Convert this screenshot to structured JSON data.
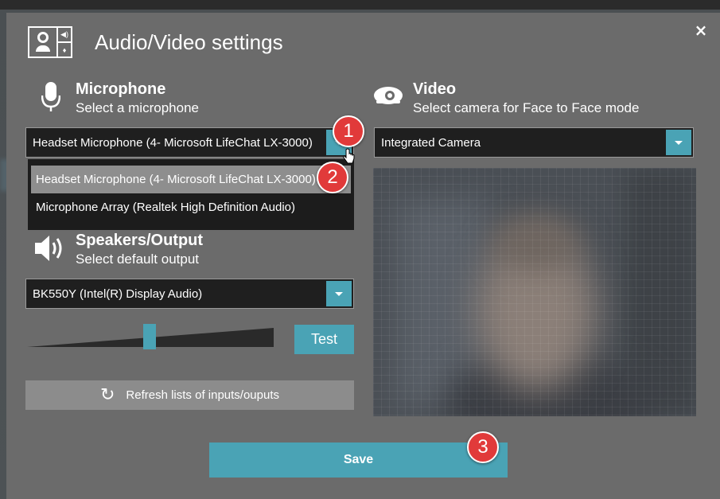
{
  "dialog": {
    "title": "Audio/Video settings",
    "close_label": "×"
  },
  "microphone": {
    "title": "Microphone",
    "subtitle": "Select a microphone",
    "selected": "Headset Microphone (4- Microsoft LifeChat LX-3000)",
    "options": [
      "Headset Microphone (4- Microsoft LifeChat LX-3000)",
      "Microphone Array (Realtek High Definition Audio)"
    ]
  },
  "speakers": {
    "title": "Speakers/Output",
    "subtitle": "Select default output",
    "selected": "BK550Y (Intel(R) Display Audio)",
    "volume_fraction": 0.5,
    "test_label": "Test"
  },
  "refresh": {
    "label": "Refresh lists of inputs/ouputs"
  },
  "video": {
    "title": "Video",
    "subtitle": "Select camera for Face to Face mode",
    "selected": "Integrated Camera"
  },
  "save_label": "Save",
  "callouts": [
    "1",
    "2",
    "3"
  ],
  "colors": {
    "accent": "#4aa3b5",
    "callout": "#e13a3a",
    "dialog_bg": "#6b6b6b"
  }
}
